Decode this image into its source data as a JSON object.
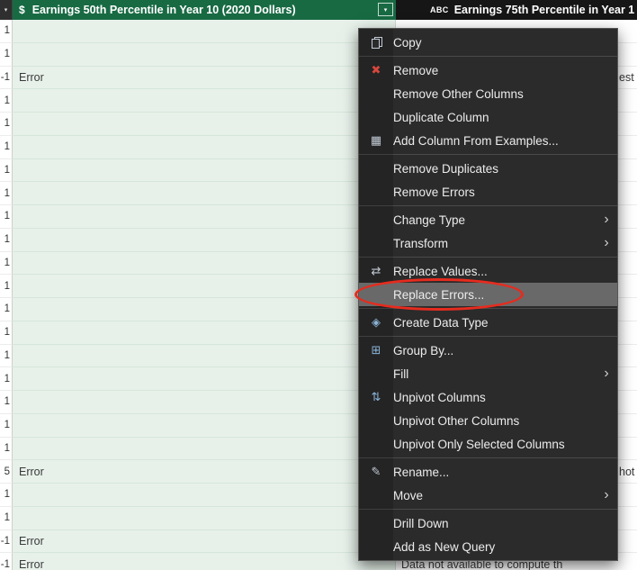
{
  "grid": {
    "corner_arrow": "▾",
    "error_text": "Error",
    "columns": [
      {
        "type_icon": "$",
        "title": "Earnings 50th Percentile in Year 10 (2020 Dollars)",
        "filter_arrow": "▾",
        "header_color": "#186a43",
        "selected": true
      },
      {
        "type_icon": "ABC",
        "title": "Earnings 75th Percentile in Year 1"
      }
    ],
    "rows": [
      {
        "left": "1"
      },
      {
        "left": "1"
      },
      {
        "left": "-1",
        "error": true,
        "right": "est",
        "right_clipped": true
      },
      {
        "left": "1"
      },
      {
        "left": "1"
      },
      {
        "left": "1"
      },
      {
        "left": "1"
      },
      {
        "left": "1"
      },
      {
        "left": "1"
      },
      {
        "left": "1"
      },
      {
        "left": "1"
      },
      {
        "left": "1"
      },
      {
        "left": "1"
      },
      {
        "left": "1"
      },
      {
        "left": "1"
      },
      {
        "left": "1"
      },
      {
        "left": "1"
      },
      {
        "left": "1"
      },
      {
        "left": "1"
      },
      {
        "left": "5",
        "error": true,
        "right": "hot",
        "right_clipped": true
      },
      {
        "left": "1"
      },
      {
        "left": "1"
      },
      {
        "left": "-1",
        "error": true
      },
      {
        "left": "-1",
        "error": true,
        "right": "Data not available to compute th"
      }
    ],
    "cell_green_color": "#e7f1ea"
  },
  "menu": {
    "background": "#2b2b2b",
    "highlight_color": "#696969",
    "submenu_arrow": "›",
    "items": [
      {
        "label": "Copy",
        "icon": "copy-icon"
      },
      {
        "sep": true
      },
      {
        "label": "Remove",
        "icon": "remove-icon",
        "glyph": "✖",
        "glyph_color": "#d8473d"
      },
      {
        "label": "Remove Other Columns"
      },
      {
        "label": "Duplicate Column"
      },
      {
        "label": "Add Column From Examples...",
        "icon": "add-column-from-examples-icon",
        "glyph": "▦",
        "glyph_color": "#c3cbd6"
      },
      {
        "sep": true
      },
      {
        "label": "Remove Duplicates"
      },
      {
        "label": "Remove Errors"
      },
      {
        "sep": true
      },
      {
        "label": "Change Type",
        "submenu": true
      },
      {
        "label": "Transform",
        "submenu": true
      },
      {
        "sep": true
      },
      {
        "label": "Replace Values...",
        "icon": "replace-values-icon",
        "glyph": "⇄",
        "glyph_color": "#c3cbd6"
      },
      {
        "label": "Replace Errors...",
        "highlighted": true,
        "annotated": true
      },
      {
        "sep": true
      },
      {
        "label": "Create Data Type",
        "icon": "create-data-type-icon",
        "glyph": "◈",
        "glyph_color": "#8ab4d8"
      },
      {
        "sep": true
      },
      {
        "label": "Group By...",
        "icon": "group-by-icon",
        "glyph": "⊞",
        "glyph_color": "#8ab4d8"
      },
      {
        "label": "Fill",
        "submenu": true
      },
      {
        "label": "Unpivot Columns",
        "icon": "unpivot-columns-icon",
        "glyph": "⇅",
        "glyph_color": "#8ab4d8"
      },
      {
        "label": "Unpivot Other Columns"
      },
      {
        "label": "Unpivot Only Selected Columns"
      },
      {
        "sep": true
      },
      {
        "label": "Rename...",
        "icon": "rename-icon",
        "glyph": "✎",
        "glyph_color": "#c3cbd6"
      },
      {
        "label": "Move",
        "submenu": true
      },
      {
        "sep": true
      },
      {
        "label": "Drill Down"
      },
      {
        "label": "Add as New Query"
      }
    ]
  },
  "annotation": {
    "shape": "ellipse",
    "color": "#e62b1e",
    "target": "Replace Errors..."
  }
}
